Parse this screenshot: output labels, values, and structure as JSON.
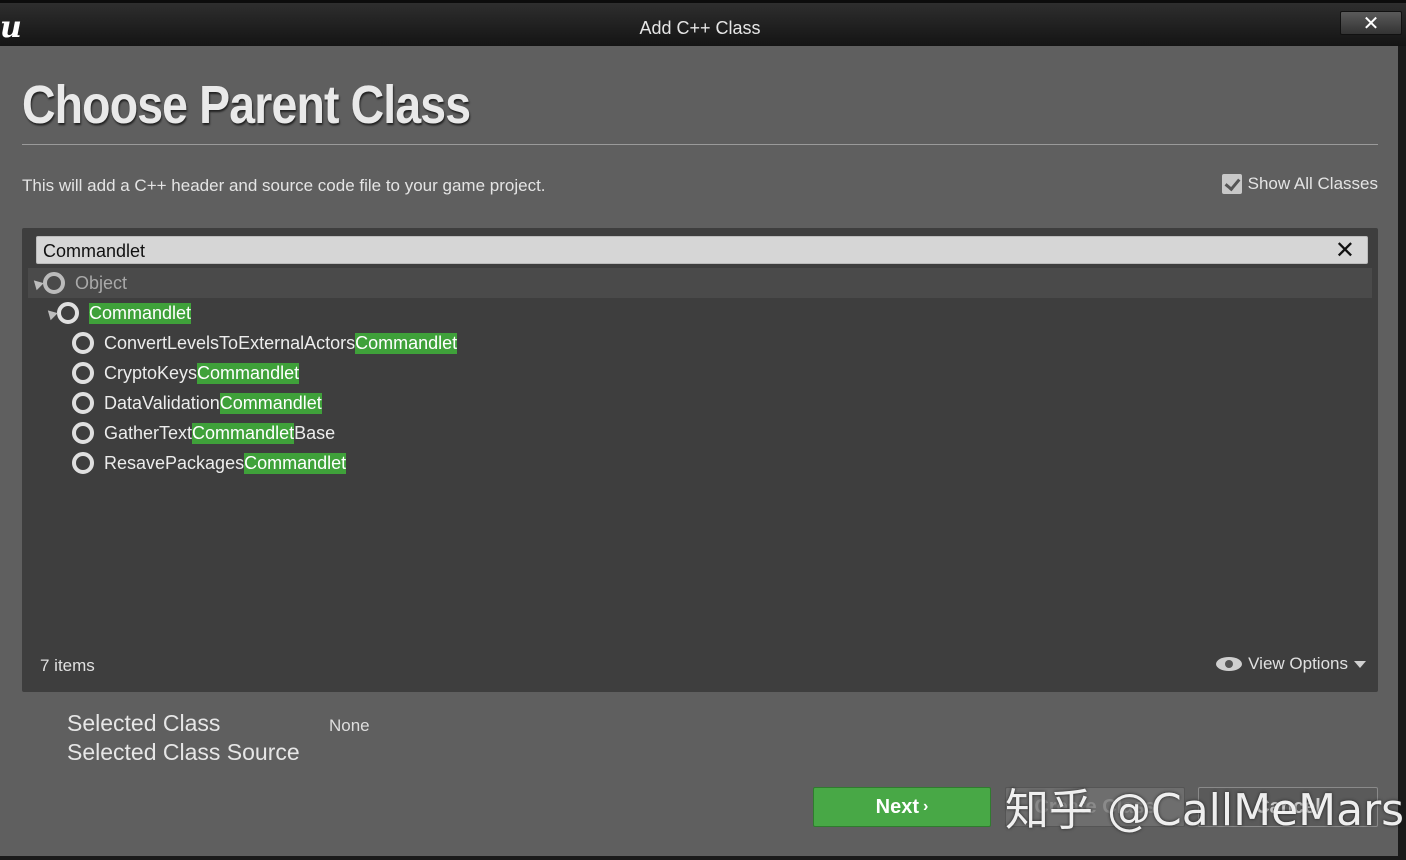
{
  "window": {
    "title": "Add C++ Class",
    "logo": "u",
    "close_label": "✕"
  },
  "header": {
    "title": "Choose Parent Class",
    "description": "This will add a C++ header and source code file to your game project.",
    "show_all_classes": {
      "label": "Show All Classes",
      "checked": true
    }
  },
  "search": {
    "value": "Commandlet",
    "clear_icon": "close-icon"
  },
  "tree": {
    "root": {
      "label": "Object",
      "expanded": true
    },
    "parent": {
      "label": "Commandlet",
      "expanded": true,
      "highlighted": true
    },
    "children": [
      {
        "prefix": "ConvertLevelsToExternalActors",
        "match": "Commandlet",
        "suffix": ""
      },
      {
        "prefix": "CryptoKeys",
        "match": "Commandlet",
        "suffix": ""
      },
      {
        "prefix": "DataValidation",
        "match": "Commandlet",
        "suffix": ""
      },
      {
        "prefix": "GatherText",
        "match": "Commandlet",
        "suffix": "Base"
      },
      {
        "prefix": "ResavePackages",
        "match": "Commandlet",
        "suffix": ""
      }
    ]
  },
  "footer": {
    "item_count": "7 items",
    "view_options": "View Options"
  },
  "selection": {
    "class_label": "Selected Class",
    "class_value": "None",
    "source_label": "Selected Class Source"
  },
  "buttons": {
    "next": "Next",
    "create": "Create Class",
    "cancel": "Cancel"
  },
  "watermark": "知乎 @CallMeMars",
  "colors": {
    "highlight": "#3fa13a",
    "next_button": "#48a846",
    "dialog_bg": "#5f5f5f",
    "panel_bg": "#3e3e3e"
  }
}
